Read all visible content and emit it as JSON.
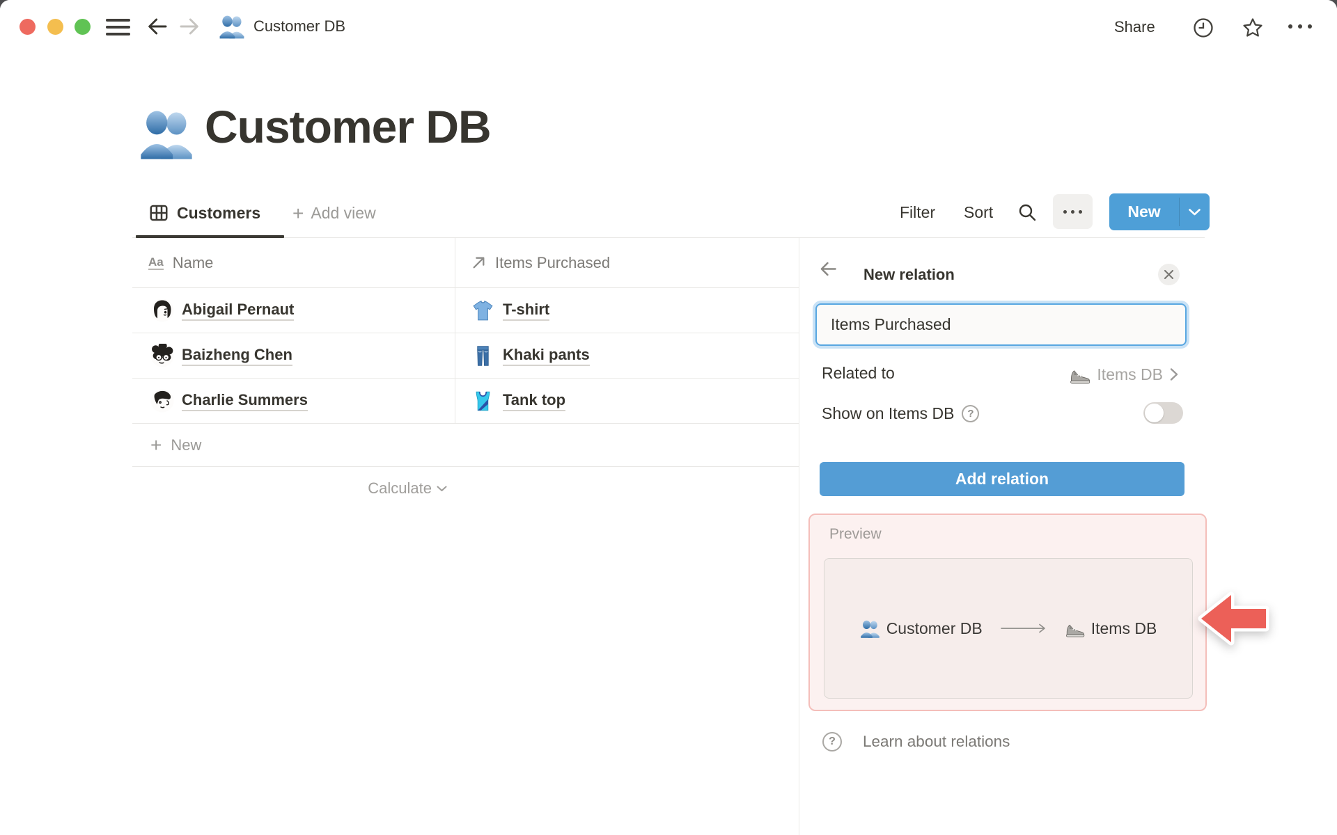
{
  "window": {
    "title": "Customer DB"
  },
  "titlebar": {
    "share_label": "Share"
  },
  "page": {
    "title": "Customer DB"
  },
  "view_bar": {
    "tab": "Customers",
    "add_view": "Add view",
    "filter": "Filter",
    "sort": "Sort",
    "new_button": "New"
  },
  "icons": {
    "text_field_glyph": "Aa",
    "plus_glyph": "+",
    "question_glyph": "?"
  },
  "table": {
    "columns": [
      {
        "label": "Name",
        "icon": "text-aa-icon"
      },
      {
        "label": "Items Purchased",
        "icon": "arrow-up-right-icon"
      }
    ],
    "rows": [
      {
        "name": "Abigail Pernaut",
        "item": "T-shirt",
        "item_icon": "tshirt-icon",
        "avatar_icon": "avatar-abigail"
      },
      {
        "name": "Baizheng Chen",
        "item": "Khaki pants",
        "item_icon": "jeans-icon",
        "avatar_icon": "avatar-baizheng"
      },
      {
        "name": "Charlie Summers",
        "item": "Tank top",
        "item_icon": "tanktop-icon",
        "avatar_icon": "avatar-charlie"
      }
    ],
    "new_row": "New",
    "calculate": "Calculate"
  },
  "panel": {
    "title": "New relation",
    "name_input": {
      "value": "Items Purchased"
    },
    "related_to": {
      "label": "Related to",
      "value": "Items DB",
      "icon": "sneaker-icon"
    },
    "show_on": {
      "label": "Show on Items DB"
    },
    "add_button": "Add relation",
    "preview": {
      "label": "Preview",
      "source": "Customer DB",
      "source_icon": "people-icon",
      "target": "Items DB",
      "target_icon": "sneaker-icon"
    },
    "learn_link": "Learn about relations"
  },
  "colors": {
    "accent_blue": "#4e9fd7",
    "focus_blue": "#58a6e1",
    "preview_bg": "#fcf1f0",
    "preview_border": "#f4beba",
    "annotation_red": "#ec6058",
    "text_dark": "#37352f"
  }
}
